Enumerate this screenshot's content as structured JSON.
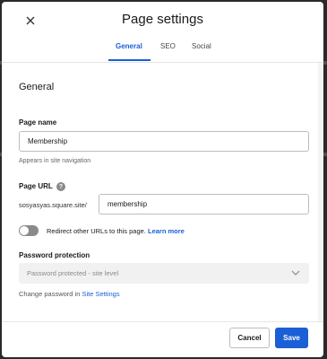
{
  "modal": {
    "title": "Page settings",
    "close_icon": "close-icon"
  },
  "tabs": [
    {
      "label": "General",
      "active": true
    },
    {
      "label": "SEO",
      "active": false
    },
    {
      "label": "Social",
      "active": false
    }
  ],
  "general": {
    "section_title": "General",
    "page_name": {
      "label": "Page name",
      "value": "Membership",
      "hint": "Appears in site navigation"
    },
    "page_url": {
      "label": "Page URL",
      "help_icon": "?",
      "prefix": "sosyasyas.square.site/",
      "value": "membership"
    },
    "redirect": {
      "enabled": false,
      "text": "Redirect other URLs to this page.",
      "link": "Learn more"
    },
    "password": {
      "label": "Password protection",
      "selected": "Password protected - site level",
      "change_text": "Change password in",
      "change_link": "Site Settings"
    }
  },
  "footer": {
    "cancel_label": "Cancel",
    "save_label": "Save"
  },
  "colors": {
    "accent": "#1a5fd6",
    "toggle_off": "#8a8a8a",
    "select_bg": "#f1f1f1"
  }
}
